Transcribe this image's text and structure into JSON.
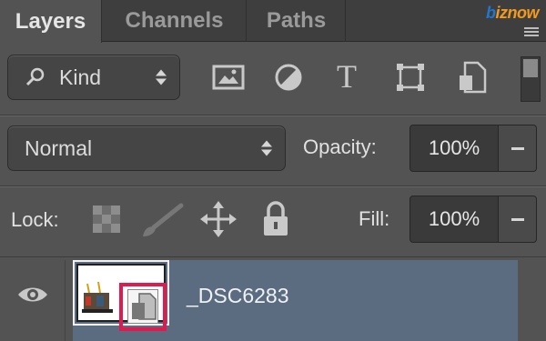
{
  "tabs": [
    {
      "label": "Layers",
      "active": true
    },
    {
      "label": "Channels",
      "active": false
    },
    {
      "label": "Paths",
      "active": false
    }
  ],
  "watermark": {
    "prefix": "b",
    "text": "iznow"
  },
  "filter": {
    "select_label": "Kind",
    "icons": [
      "image-filter-icon",
      "adjustment-filter-icon",
      "type-filter-icon",
      "shape-filter-icon",
      "smart-object-filter-icon"
    ],
    "type_glyph": "T"
  },
  "blend": {
    "mode": "Normal",
    "opacity_label": "Opacity:",
    "opacity_value": "100%"
  },
  "lock": {
    "label": "Lock:",
    "fill_label": "Fill:",
    "fill_value": "100%"
  },
  "layer": {
    "name": "_DSC6283",
    "visible": true,
    "selected": true
  },
  "colors": {
    "panel": "#535353",
    "selected_row": "#5c6c80",
    "highlight": "#e0194f"
  }
}
